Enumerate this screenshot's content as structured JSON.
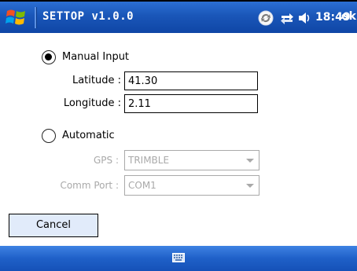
{
  "titlebar": {
    "app_title": "SETTOP v1.0.0",
    "clock": "18:49",
    "ok_label": "ok",
    "icons": [
      "windows-flag-icon",
      "sync-icon",
      "connectivity-icon",
      "volume-icon"
    ]
  },
  "manual": {
    "label": "Manual Input",
    "selected": true,
    "latitude_label": "Latitude :",
    "latitude_value": "41.30",
    "longitude_label": "Longitude :",
    "longitude_value": "2.11"
  },
  "automatic": {
    "label": "Automatic",
    "selected": false,
    "gps_label": "GPS :",
    "gps_value": "TRIMBLE",
    "commport_label": "Comm Port :",
    "commport_value": "COM1"
  },
  "actions": {
    "cancel_label": "Cancel"
  },
  "colors": {
    "titlebar": "#1a56b8",
    "bottombar": "#1f60c8",
    "button_bg": "#e1ebfa",
    "disabled_text": "#a9a9a9"
  }
}
